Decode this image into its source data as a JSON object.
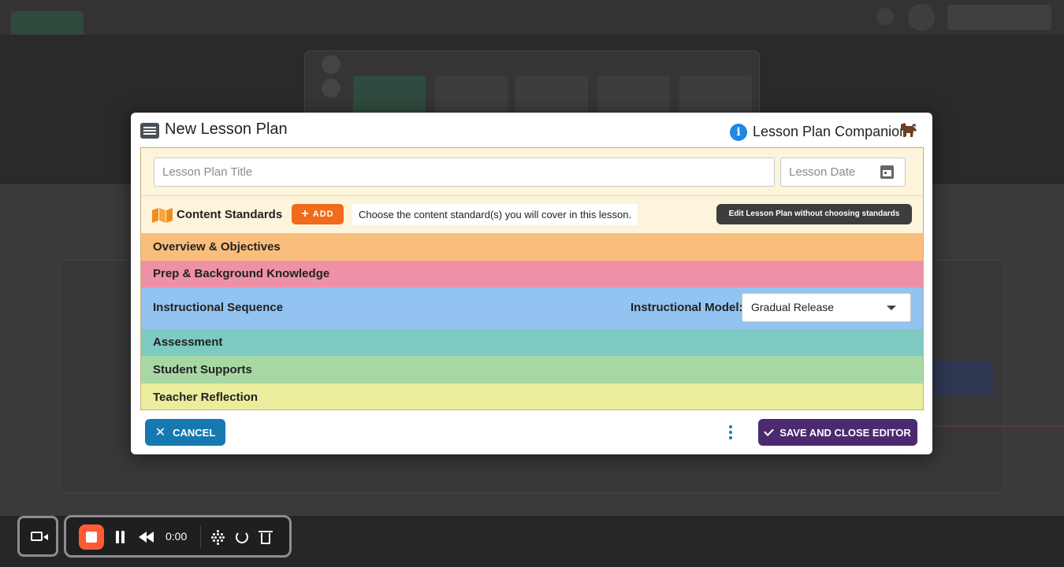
{
  "modal": {
    "title": "New Lesson Plan",
    "companion_label": "Lesson Plan Companion",
    "title_placeholder": "Lesson Plan Title",
    "date_placeholder": "Lesson Date",
    "content_standards": {
      "label": "Content Standards",
      "add_label": "ADD",
      "hint": "Choose the content standard(s) you will cover in this lesson.",
      "edit_without_label": "Edit Lesson Plan without choosing standards"
    },
    "sections": {
      "overview": "Overview & Objectives",
      "prep": "Prep & Background Knowledge",
      "instructional": "Instructional Sequence",
      "assessment": "Assessment",
      "supports": "Student Supports",
      "reflection": "Teacher Reflection"
    },
    "instructional_model": {
      "label": "Instructional Model:",
      "selected": "Gradual Release"
    },
    "footer": {
      "cancel_label": "CANCEL",
      "save_label": "SAVE AND CLOSE EDITOR"
    }
  },
  "recorder": {
    "timer": "0:00"
  },
  "colors": {
    "overview": "#f9be7c",
    "prep": "#ee91a8",
    "instructional": "#93c3f0",
    "assessment": "#7ccac2",
    "supports": "#a7d8a4",
    "reflection": "#eaed9c",
    "add_button": "#f26a1b",
    "cancel_button": "#1679b0",
    "save_button": "#4b2a6f",
    "record_stop": "#ff5a36"
  },
  "icons": [
    "list-icon",
    "info-icon",
    "dog-icon",
    "calendar-icon",
    "map-icon",
    "plus-icon",
    "dropdown-caret-icon",
    "close-icon",
    "more-vertical-icon",
    "check-icon",
    "camera-icon",
    "stop-icon",
    "pause-icon",
    "rewind-icon",
    "drag-handle-icon",
    "restart-icon",
    "trash-icon"
  ]
}
